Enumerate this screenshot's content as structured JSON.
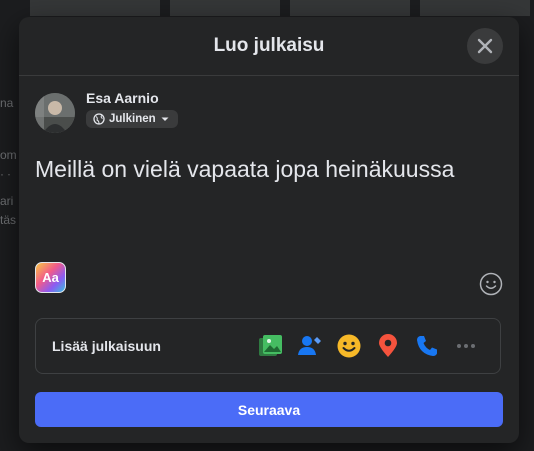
{
  "background": {
    "left_snippets": [
      "na",
      "om",
      "· ∙",
      "ari",
      "täs"
    ]
  },
  "modal": {
    "title": "Luo julkaisu",
    "user": {
      "name": "Esa Aarnio",
      "audience_label": "Julkinen"
    },
    "post_text": "Meillä on vielä vapaata jopa heinäkuussa",
    "background_picker_label": "Aa",
    "add_to_post": {
      "label": "Lisää julkaisuun",
      "icons": [
        "photo-video-icon",
        "tag-people-icon",
        "feeling-icon",
        "check-in-icon",
        "call-icon",
        "more-icon"
      ]
    },
    "next_button": "Seuraava"
  },
  "colors": {
    "modal_bg": "#242526",
    "accent": "#4b6cf7",
    "photo_green": "#45bd62",
    "tag_blue": "#1877f2",
    "feeling_yellow": "#f7b928",
    "checkin_red": "#f5533d",
    "call_blue": "#1877f2"
  }
}
